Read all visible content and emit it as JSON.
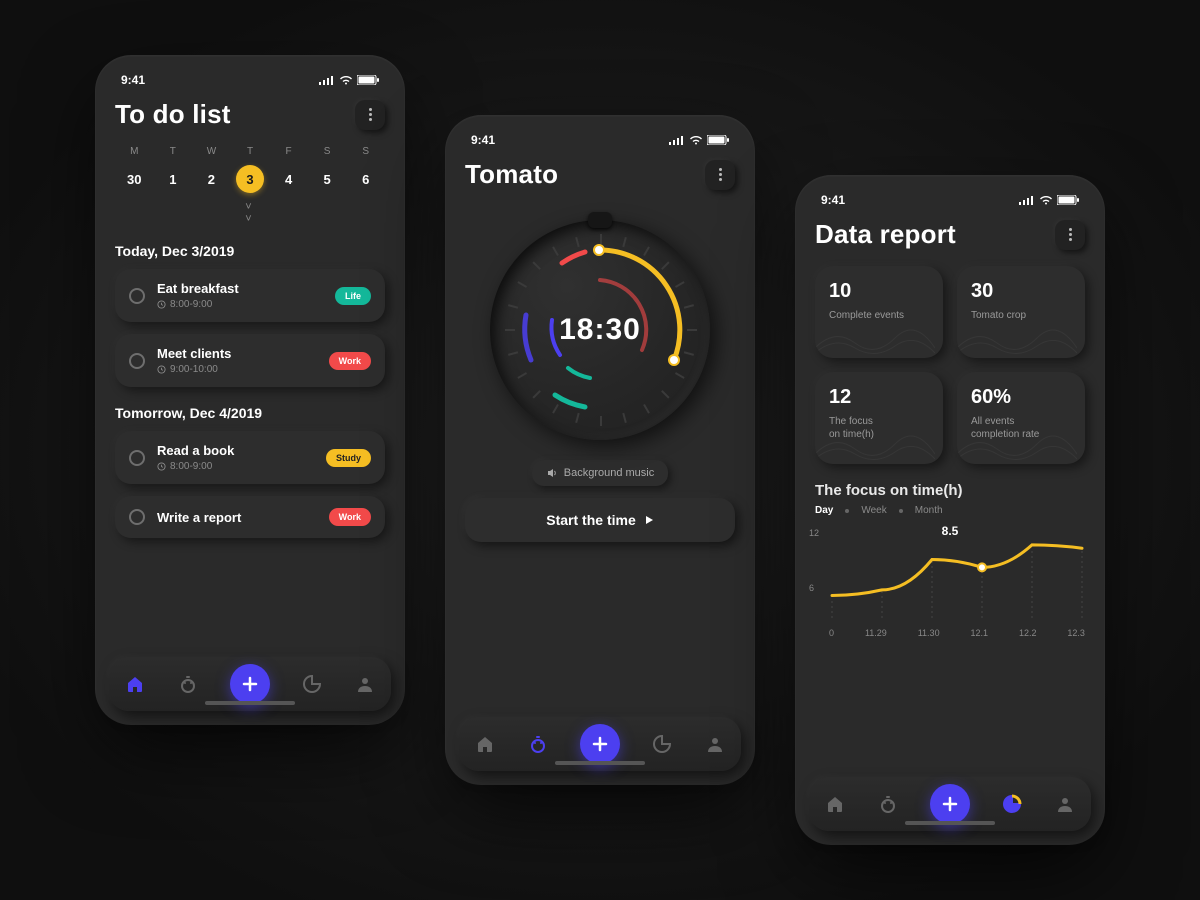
{
  "status_time": "9:41",
  "colors": {
    "accent_purple": "#4c3ff0",
    "accent_yellow": "#f5be23",
    "life": "#14b89a",
    "work": "#f24a4a",
    "study": "#f5be23"
  },
  "todo": {
    "title": "To do list",
    "weekday_letters": [
      "M",
      "T",
      "W",
      "T",
      "F",
      "S",
      "S"
    ],
    "dates": [
      "30",
      "1",
      "2",
      "3",
      "4",
      "5",
      "6"
    ],
    "selected_date_index": 3,
    "section_today": "Today, Dec 3/2019",
    "section_tomorrow": "Tomorrow, Dec 4/2019",
    "tasks_today": [
      {
        "title": "Eat breakfast",
        "time": "8:00-9:00",
        "tag": "Life",
        "tag_class": "life"
      },
      {
        "title": "Meet clients",
        "time": "9:00-10:00",
        "tag": "Work",
        "tag_class": "work"
      }
    ],
    "tasks_tomorrow": [
      {
        "title": "Read a book",
        "time": "8:00-9:00",
        "tag": "Study",
        "tag_class": "study"
      },
      {
        "title": "Write a report",
        "time": "",
        "tag": "Work",
        "tag_class": "work"
      }
    ]
  },
  "tomato": {
    "title": "Tomato",
    "time_display": "18:30",
    "bg_music": "Background music",
    "start": "Start the time"
  },
  "report": {
    "title": "Data report",
    "stats": [
      {
        "value": "10",
        "label": "Complete events"
      },
      {
        "value": "30",
        "label": "Tomato crop"
      },
      {
        "value": "12",
        "label": "The focus\non time(h)"
      },
      {
        "value": "60%",
        "label": "All events\ncompletion rate"
      }
    ],
    "chart_title": "The focus on time(h)",
    "chart_tabs": [
      "Day",
      "Week",
      "Month"
    ],
    "chart_active_tab": 0,
    "chart_callout": "8.5"
  },
  "chart_data": {
    "type": "line",
    "title": "The focus on time(h)",
    "x": [
      "0",
      "11.29",
      "11.30",
      "12.1",
      "12.2",
      "12.3"
    ],
    "values": [
      6.0,
      6.5,
      9.2,
      8.5,
      10.5,
      10.2
    ],
    "highlight_index": 3,
    "highlight_value": 8.5,
    "ylabels": [
      12,
      6
    ],
    "ylim": [
      4,
      12
    ],
    "xlabel": "",
    "ylabel": ""
  }
}
